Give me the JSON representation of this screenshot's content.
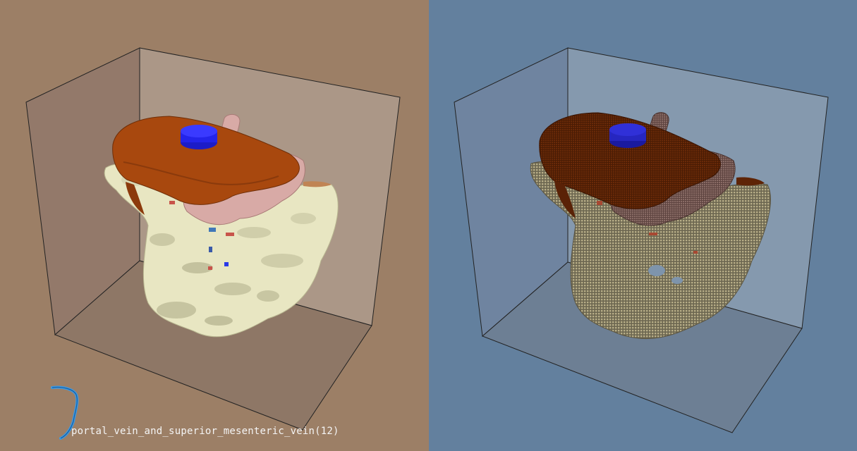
{
  "viewports": {
    "left": {
      "name": "surface-render",
      "background": "#9c7f66",
      "structure_label": "portal_vein_and_superior_mesenteric_vein(12)",
      "legend_icon": "vessel-thumbnail-icon",
      "legend_color": "#3a9ae6"
    },
    "right": {
      "name": "voxel-render",
      "background": "#63809e"
    }
  },
  "structures": [
    {
      "name": "liver",
      "color_surface": "#a84a10",
      "color_voxel": "#5e2406"
    },
    {
      "name": "stomach",
      "color_surface": "#d6a6a4",
      "color_voxel": "#7e5e58"
    },
    {
      "name": "aorta",
      "color_surface": "#2020e8",
      "color_voxel": "#2626c0"
    },
    {
      "name": "bone",
      "color_surface": "#ecebc8",
      "color_voxel": "#857b5e"
    },
    {
      "name": "vessels",
      "color_surface": "#c8544a",
      "color_voxel": "#a84832"
    }
  ]
}
